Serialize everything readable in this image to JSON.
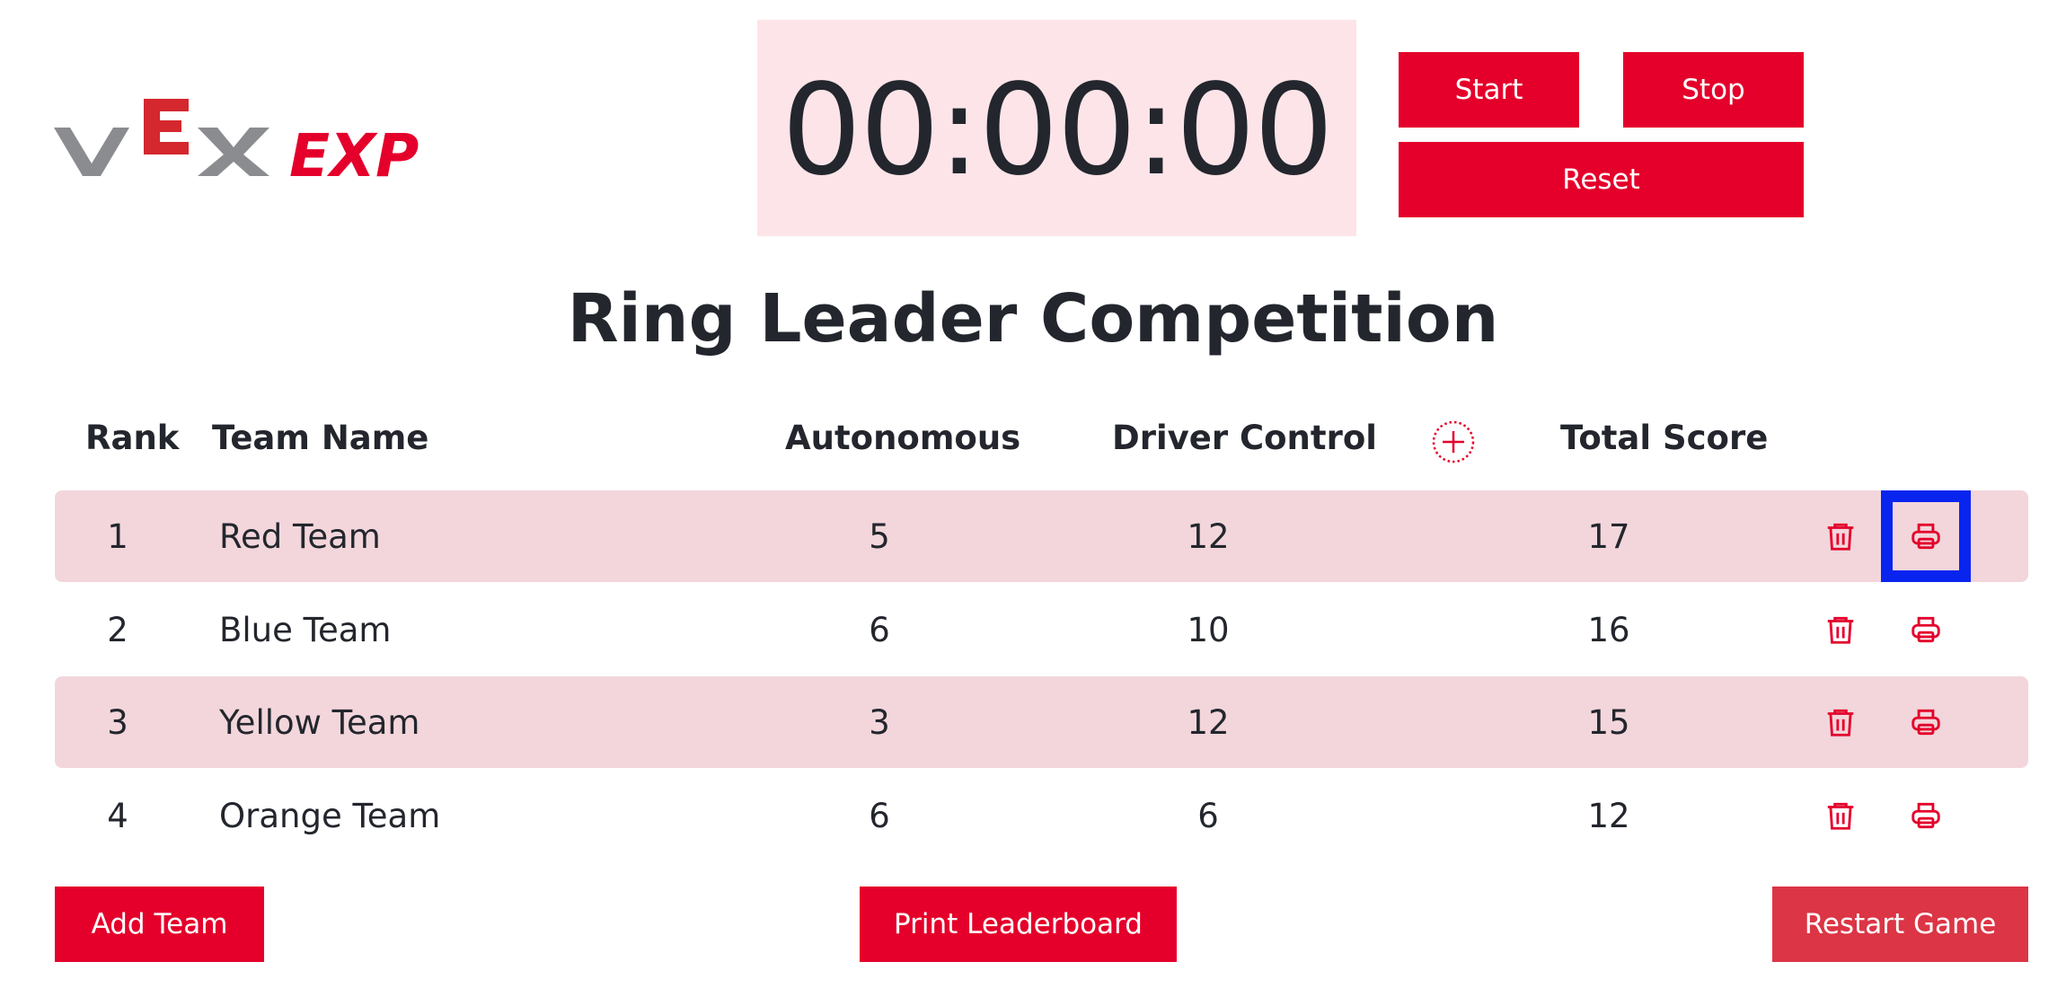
{
  "logo": {
    "wordmark_left": "VEX",
    "wordmark_right": "EXP",
    "colors": {
      "gray": "#8a8c8f",
      "red": "#e4002b"
    }
  },
  "timer": {
    "display": "00:00:00",
    "background": "#fde4e8"
  },
  "controls": {
    "start_label": "Start",
    "stop_label": "Stop",
    "reset_label": "Reset"
  },
  "title": "Ring Leader Competition",
  "table": {
    "headers": {
      "rank": "Rank",
      "team_name": "Team Name",
      "autonomous": "Autonomous",
      "driver_control": "Driver Control",
      "total_score": "Total Score"
    },
    "rows": [
      {
        "rank": "1",
        "team_name": "Red Team",
        "autonomous": "5",
        "driver_control": "12",
        "total_score": "17"
      },
      {
        "rank": "2",
        "team_name": "Blue Team",
        "autonomous": "6",
        "driver_control": "10",
        "total_score": "16"
      },
      {
        "rank": "3",
        "team_name": "Yellow Team",
        "autonomous": "3",
        "driver_control": "12",
        "total_score": "15"
      },
      {
        "rank": "4",
        "team_name": "Orange Team",
        "autonomous": "6",
        "driver_control": "6",
        "total_score": "12"
      }
    ],
    "row_actions": [
      "trash-icon",
      "printer-icon"
    ],
    "header_action_icon": "plus-circle-icon"
  },
  "footer": {
    "add_team_label": "Add Team",
    "print_leaderboard_label": "Print Leaderboard",
    "restart_game_label": "Restart Game"
  },
  "colors": {
    "accent": "#e4002b",
    "restart": "#dc3545",
    "row_shade": "#f2d6db",
    "focus_outline": "#0a24f0",
    "text": "#23262d"
  }
}
